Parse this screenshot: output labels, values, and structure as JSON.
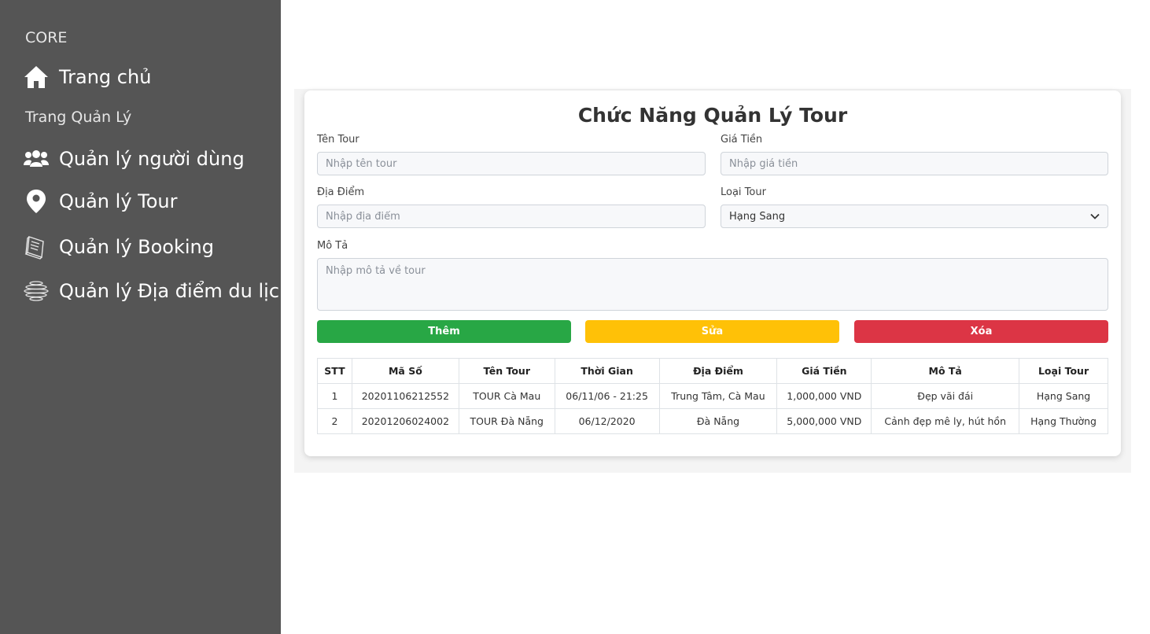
{
  "sidebar": {
    "core_heading": "CORE",
    "home": {
      "label": "Trang chủ",
      "icon": "home-icon"
    },
    "manage_heading": "Trang Quản Lý",
    "items": [
      {
        "label": "Quản lý người dùng",
        "icon": "users-icon"
      },
      {
        "label": "Quản lý Tour",
        "icon": "map-pin-icon"
      },
      {
        "label": "Quản lý Booking",
        "icon": "book-icon"
      },
      {
        "label": "Quản lý Địa điểm du lịch",
        "icon": "globe-icon"
      }
    ]
  },
  "form": {
    "title": "Chức Năng Quản Lý Tour",
    "name_label": "Tên Tour",
    "name_placeholder": "Nhập tên tour",
    "price_label": "Giá Tiền",
    "price_placeholder": "Nhập giá tiền",
    "location_label": "Địa Điểm",
    "location_placeholder": "Nhập địa điểm",
    "type_label": "Loại Tour",
    "type_selected": "Hạng Sang",
    "desc_label": "Mô Tả",
    "desc_placeholder": "Nhập mô tả về tour",
    "add_label": "Thêm",
    "edit_label": "Sửa",
    "delete_label": "Xóa"
  },
  "colors": {
    "sidebar_bg": "#555555",
    "add": "#28a745",
    "edit": "#ffc107",
    "delete": "#dc3545"
  },
  "table": {
    "headers": [
      "STT",
      "Mã Số",
      "Tên Tour",
      "Thời Gian",
      "Địa Điểm",
      "Giá Tiền",
      "Mô Tả",
      "Loại Tour"
    ],
    "rows": [
      [
        "1",
        "20201106212552",
        "TOUR Cà Mau",
        "06/11/06 - 21:25",
        "Trung Tâm, Cà Mau",
        "1,000,000 VND",
        "Đẹp vãi đái",
        "Hạng Sang"
      ],
      [
        "2",
        "20201206024002",
        "TOUR Đà Nẵng",
        "06/12/2020",
        "Đà Nẵng",
        "5,000,000 VND",
        "Cảnh đẹp mê ly, hút hồn",
        "Hạng Thường"
      ]
    ]
  }
}
